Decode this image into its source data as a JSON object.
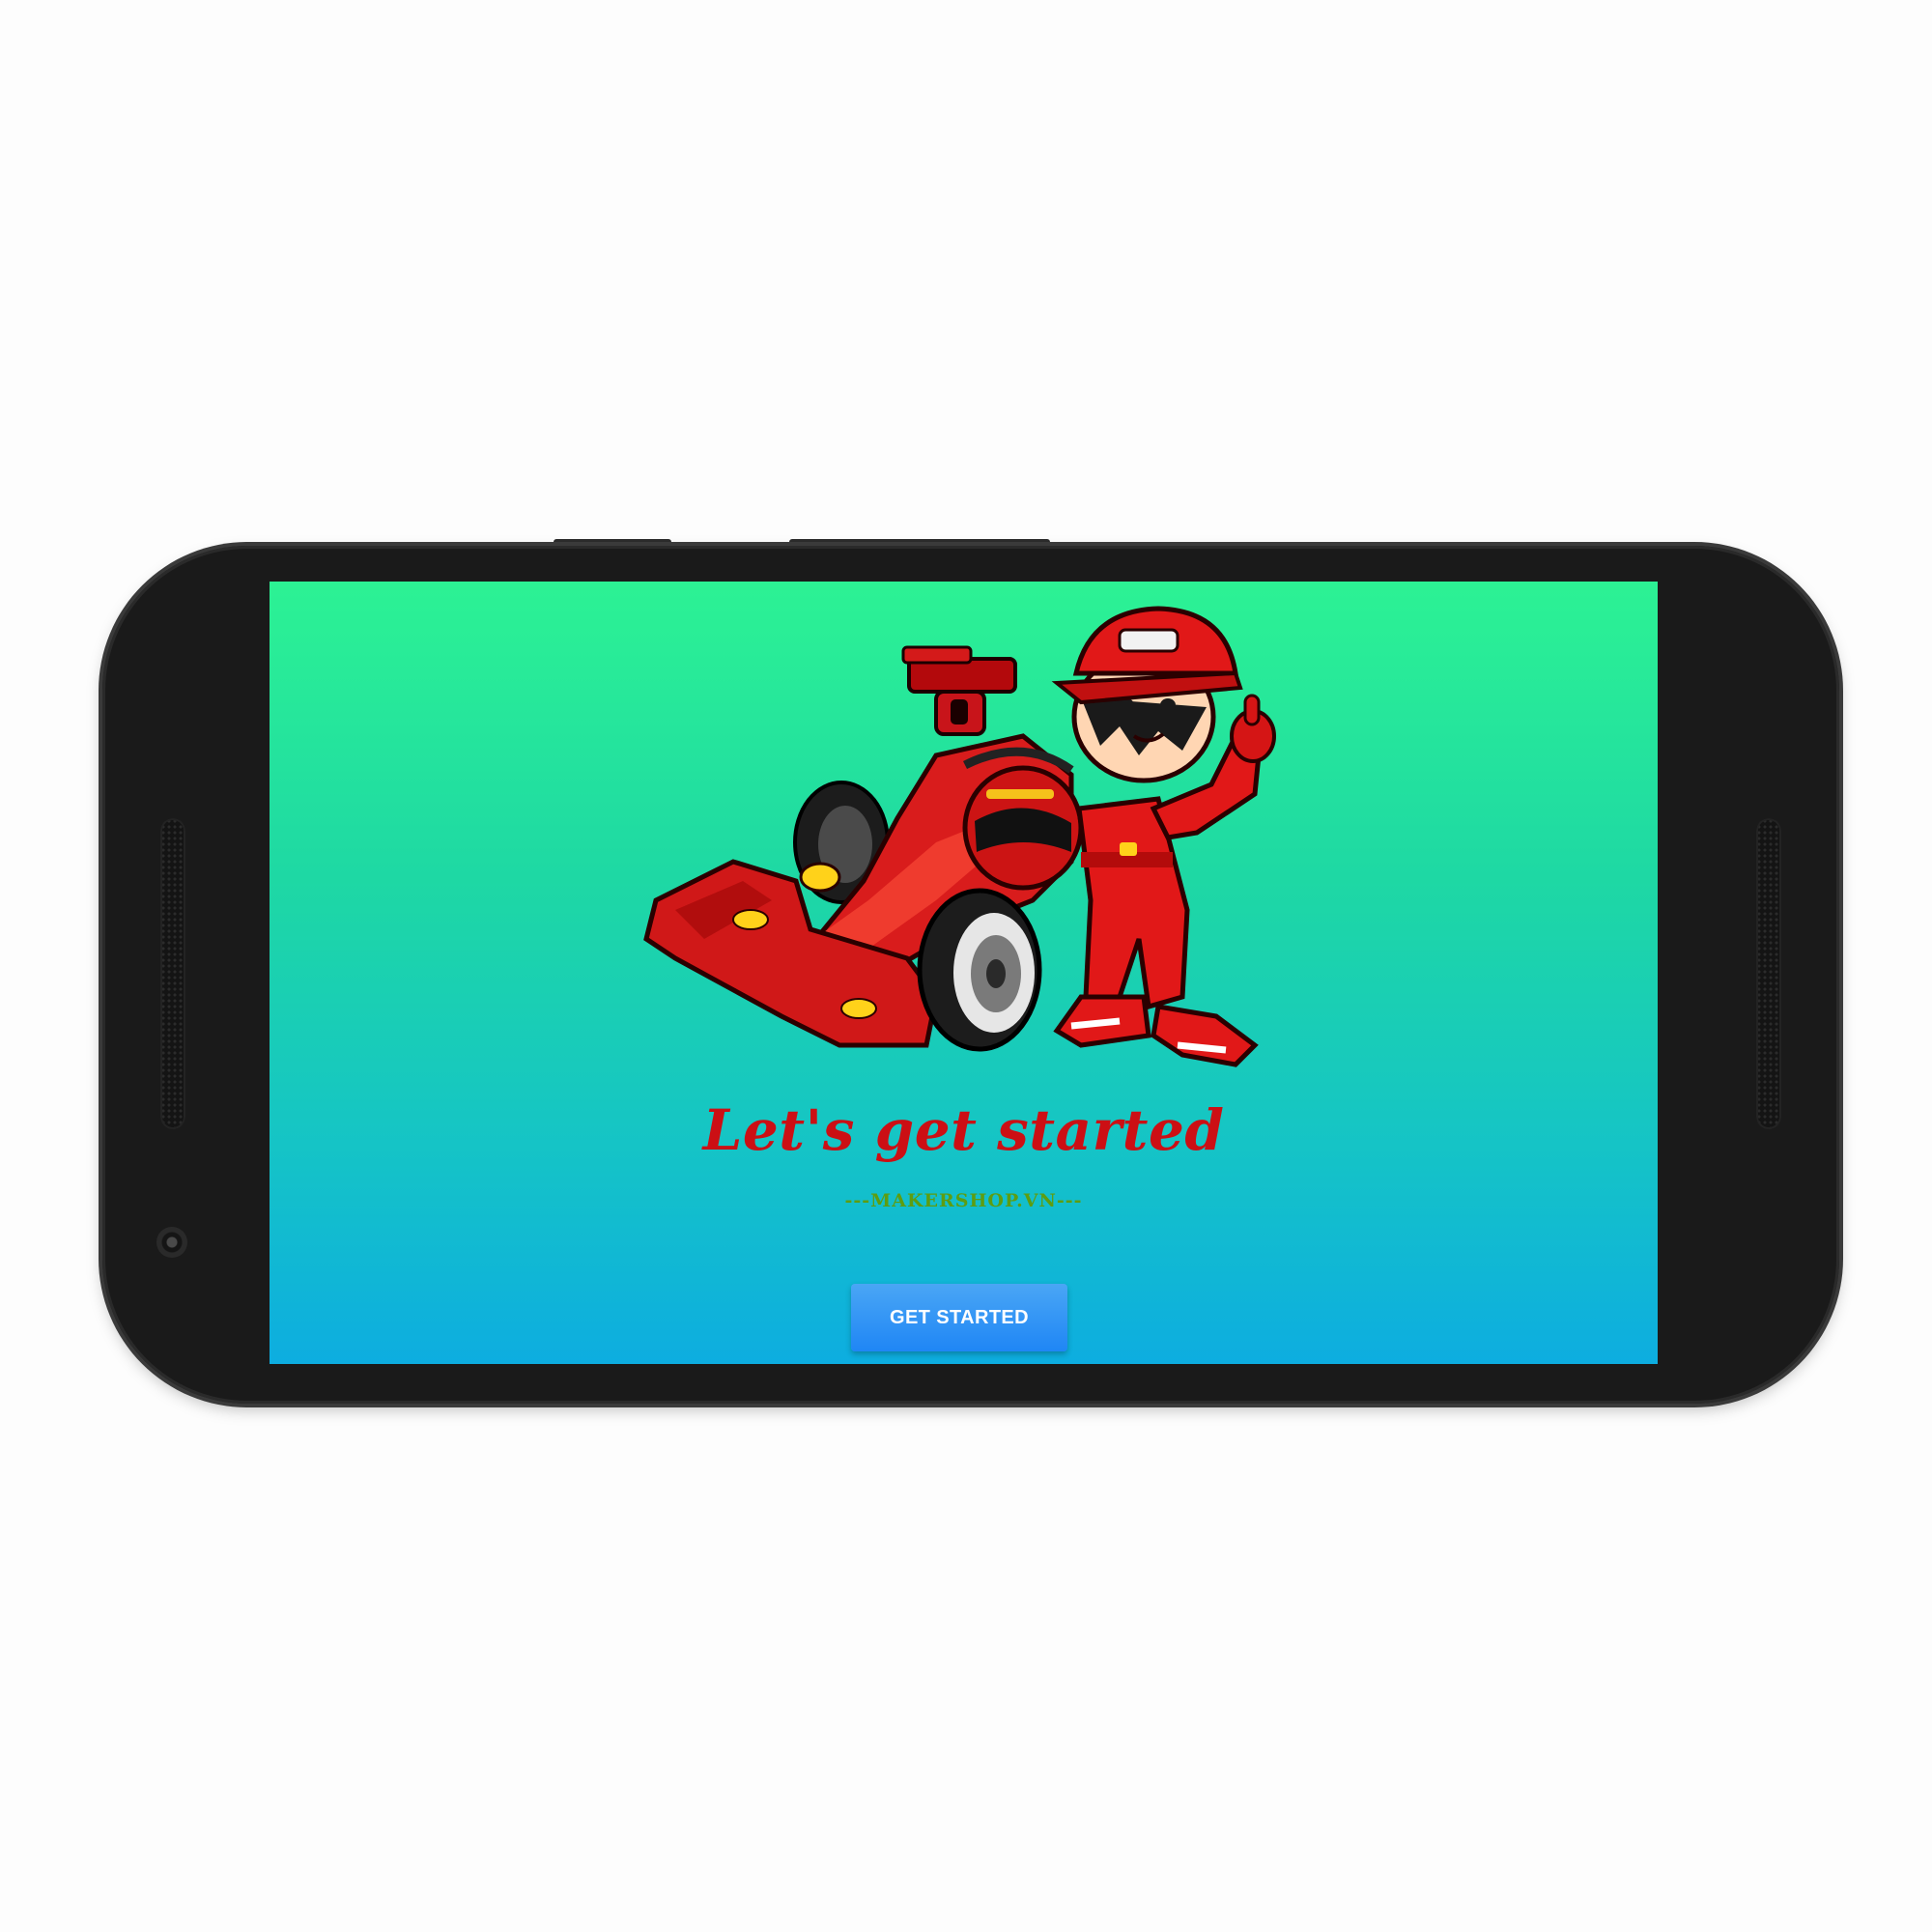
{
  "device": {
    "screen_gradient": [
      "#2cf294",
      "#0dade0"
    ],
    "bezel_color": "#1a1a1a"
  },
  "screen": {
    "illustration": {
      "icon": "race-car-driver-illustration",
      "accent_color": "#e01b1b"
    },
    "title": "Let's get started",
    "title_color": "#cc0f14",
    "brand": "---MAKERSHOP.VN---",
    "brand_color": "#5d9d12",
    "cta": {
      "label": "GET STARTED",
      "color": "#2a8cf5"
    }
  }
}
